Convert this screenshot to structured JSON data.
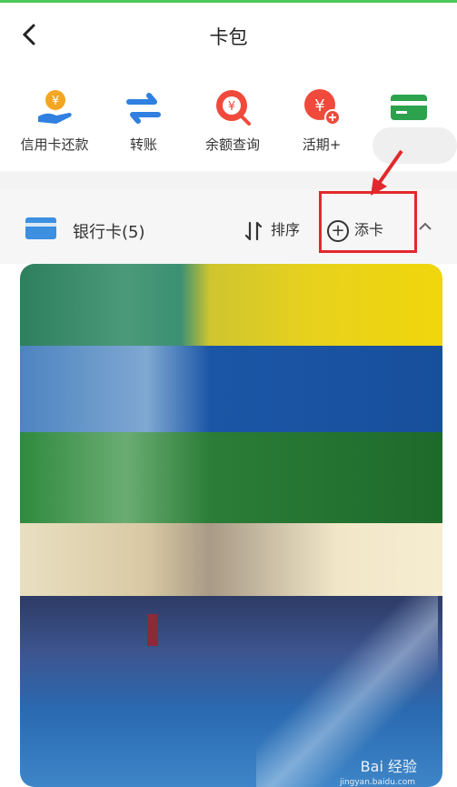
{
  "header": {
    "title": "卡包",
    "back_icon": "chevron-left-icon"
  },
  "quick_actions": [
    {
      "label": "信用卡还款",
      "icon": "hand-coin-icon",
      "color": "#f4a623"
    },
    {
      "label": "转账",
      "icon": "transfer-arrows-icon",
      "color": "#2f80e0"
    },
    {
      "label": "余额查询",
      "icon": "coin-search-icon",
      "color": "#ef4a3c"
    },
    {
      "label": "活期+",
      "icon": "coin-plus-icon",
      "color": "#ef4a3c"
    },
    {
      "label": "",
      "icon": "green-card-icon",
      "color": "#2ca24d"
    }
  ],
  "bank_section": {
    "label": "银行卡(5)",
    "sort_label": "排序",
    "add_label": "添卡",
    "collapse_icon": "chevron-up-icon"
  },
  "watermark": {
    "text": "Bai 经验",
    "sub": "jingyan.baidu.com"
  },
  "colors": {
    "accent": "#4cc85a",
    "highlight": "#e2282d"
  }
}
